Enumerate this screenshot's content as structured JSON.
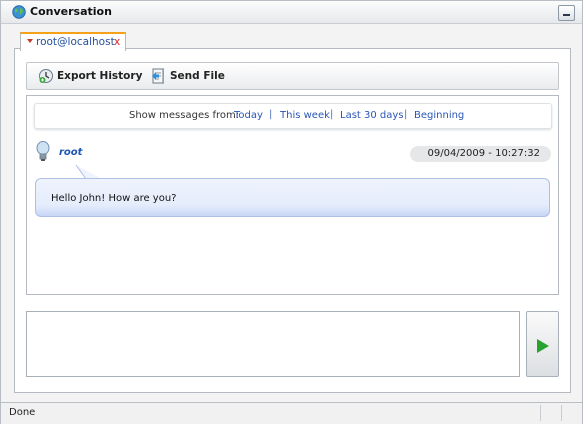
{
  "window": {
    "title": "Conversation",
    "icon": "globe-icon",
    "status": "Done"
  },
  "tab": {
    "label": "root@localhost",
    "close": "x",
    "accent": "#f4a21a"
  },
  "toolbar": {
    "export_label": "Export History",
    "send_label": "Send File"
  },
  "filter": {
    "label": "Show messages from:",
    "options": [
      "Today",
      "This week",
      "Last 30 days",
      "Beginning"
    ],
    "separator": "|"
  },
  "messages": [
    {
      "sender": "root",
      "timestamp": "09/04/2009 - 10:27:32",
      "text": "Hello John! How are you?"
    }
  ],
  "compose": {
    "value": "",
    "send_icon": "play-icon",
    "send_color": "#27a12f"
  }
}
